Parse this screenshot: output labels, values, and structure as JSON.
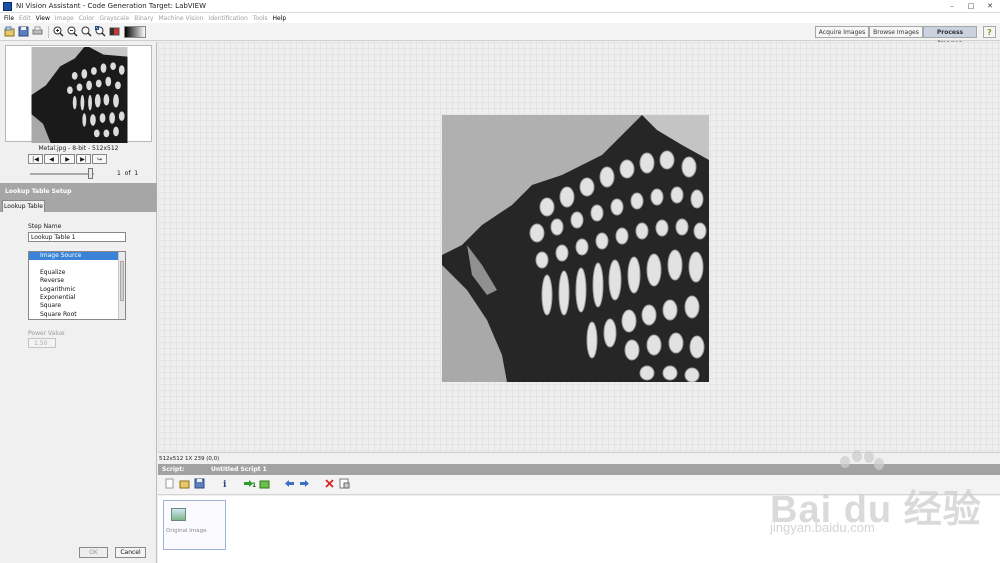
{
  "window": {
    "title": "NI Vision Assistant - Code Generation Target: LabVIEW",
    "controls": [
      "–",
      "□",
      "✕"
    ]
  },
  "menu": [
    {
      "label": "File",
      "enabled": true
    },
    {
      "label": "Edit",
      "enabled": false
    },
    {
      "label": "View",
      "enabled": true
    },
    {
      "label": "Image",
      "enabled": false
    },
    {
      "label": "Color",
      "enabled": false
    },
    {
      "label": "Grayscale",
      "enabled": false
    },
    {
      "label": "Binary",
      "enabled": false
    },
    {
      "label": "Machine Vision",
      "enabled": false
    },
    {
      "label": "Identification",
      "enabled": false
    },
    {
      "label": "Tools",
      "enabled": false
    },
    {
      "label": "Help",
      "enabled": true
    }
  ],
  "toolbar": {
    "icons": [
      "open-image-icon",
      "save-image-icon",
      "print-icon",
      "zoom-in-icon",
      "zoom-out-icon",
      "zoom-1to1-icon",
      "zoom-fit-icon",
      "color-palette-icon",
      "grayscale-palette-icon"
    ],
    "modes": [
      {
        "label": "Acquire Images",
        "active": false
      },
      {
        "label": "Browse Images",
        "active": false
      },
      {
        "label": "Process Images",
        "active": true
      }
    ],
    "help": "?"
  },
  "browser": {
    "caption": "Metal.jpg - 8-bit - 512x512",
    "nav": [
      "|◀",
      "◀",
      "▶",
      "▶|",
      "↪"
    ],
    "page_current": "1",
    "page_of": "of",
    "page_total": "1"
  },
  "setup": {
    "header": "Lookup Table Setup",
    "tab": "Lookup Table",
    "step_name_label": "Step Name",
    "step_name_value": "Lookup Table 1",
    "lut_items": [
      {
        "label": "Image Source",
        "selected": true
      },
      {
        "label": "",
        "selected": false
      },
      {
        "label": "Equalize",
        "selected": false
      },
      {
        "label": "Reverse",
        "selected": false
      },
      {
        "label": "Logarithmic",
        "selected": false
      },
      {
        "label": "Exponential",
        "selected": false
      },
      {
        "label": "Square",
        "selected": false
      },
      {
        "label": "Square Root",
        "selected": false
      }
    ],
    "power_label": "Power Value",
    "power_value": "1.50",
    "ok": "OK",
    "cancel": "Cancel"
  },
  "status": {
    "text": "512x512 1X 239   (0,0)"
  },
  "script": {
    "label": "Script:",
    "name": "Untitled Script 1",
    "tools": [
      "new-script-icon",
      "open-script-icon",
      "save-script-icon",
      "info-icon",
      "run-once-icon",
      "run-batch-icon",
      "step-back-icon",
      "step-forward-icon",
      "delete-step-icon",
      "performance-meter-icon"
    ],
    "step_label": "Original Image"
  },
  "watermark": {
    "brand": "Bai du 经验",
    "url": "jingyan.baidu.com"
  },
  "colors": {
    "selection": "#3a83d6",
    "panel_header": "#a6a6a6",
    "active_mode": "#c9d3e0"
  }
}
